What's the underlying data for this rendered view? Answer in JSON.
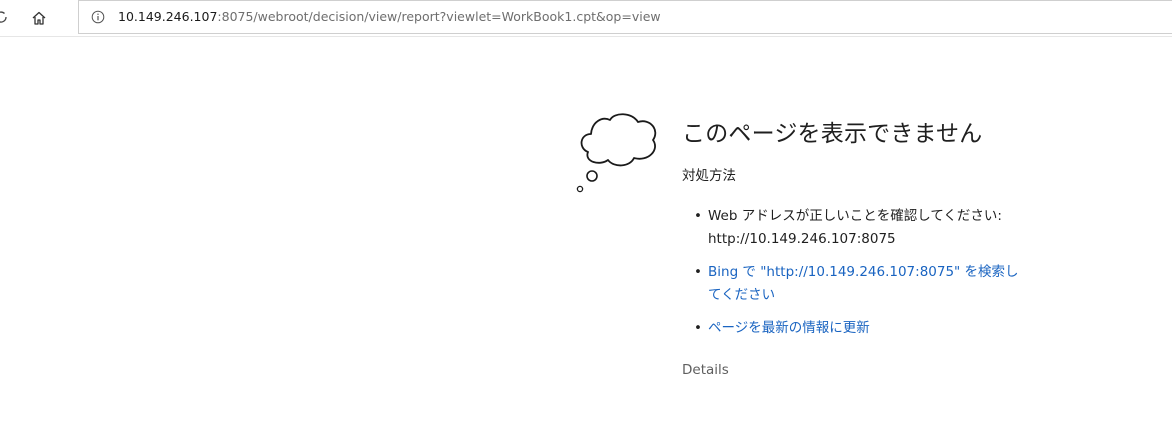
{
  "browser": {
    "url_host": "10.149.246.107",
    "url_rest": ":8075/webroot/decision/view/report?viewlet=WorkBook1.cpt&op=view",
    "icons": [
      "info-icon",
      "home-icon"
    ]
  },
  "error_page": {
    "title": "このページを表示できません",
    "section_heading": "対処方法",
    "tips": [
      {
        "text": "Web アドレスが正しいことを確認してください: http://10.149.246.107:8075"
      },
      {
        "text": "Bing で \"http://10.149.246.107:8075\" を検索してください"
      },
      {
        "text": "ページを最新の情報に更新"
      }
    ],
    "details_label": "Details",
    "link_color": "#1a64c1",
    "illustration": "thought-cloud-icon"
  }
}
